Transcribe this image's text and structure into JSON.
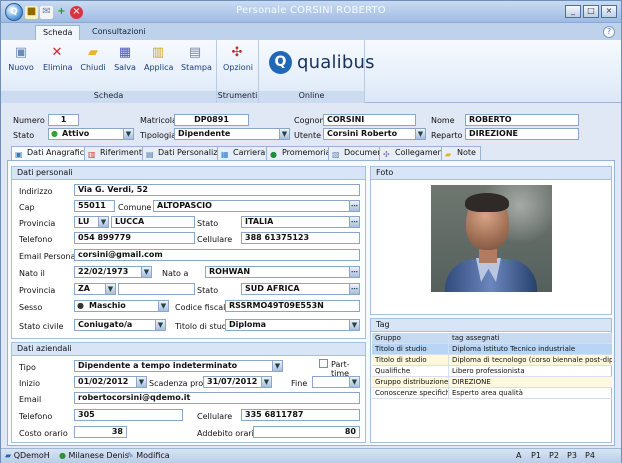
{
  "window": {
    "title": "Personale CORSINI ROBERTO"
  },
  "quick_access": [
    "document-icon",
    "email-icon",
    "add-icon",
    "close-icon"
  ],
  "ribbon_tabs": {
    "active": "Scheda",
    "other": "Consultazioni"
  },
  "ribbon": {
    "scheda": {
      "label": "Scheda",
      "buttons": [
        "Nuovo",
        "Elimina",
        "Chiudi",
        "Salva",
        "Applica",
        "Stampa"
      ]
    },
    "strumenti": {
      "label": "Strumenti",
      "buttons": [
        "Opzioni"
      ]
    },
    "online": {
      "label": "Online",
      "brand": "qualibus"
    }
  },
  "header": {
    "numero_label": "Numero",
    "numero": "1",
    "matricola_label": "Matricola",
    "matricola": "DP0891",
    "cognome_label": "Cognome",
    "cognome": "CORSINI",
    "nome_label": "Nome",
    "nome": "ROBERTO",
    "stato_label": "Stato",
    "stato": "Attivo",
    "tipologia_label": "Tipologia",
    "tipologia": "Dipendente",
    "utente_label": "Utente",
    "utente": "Corsini Roberto",
    "reparto_label": "Reparto",
    "reparto": "DIREZIONE"
  },
  "tabs": [
    "Dati Anagrafici",
    "Riferimenti",
    "Dati Personalizzati",
    "Carriera",
    "Promemoria",
    "Documenti",
    "Collegamenti",
    "Note"
  ],
  "dati_personali": {
    "title": "Dati personali",
    "indirizzo_label": "Indirizzo",
    "indirizzo": "Via G. Verdi, 52",
    "cap_label": "Cap",
    "cap": "55011",
    "comune_label": "Comune",
    "comune": "ALTOPASCIO",
    "provincia_label": "Provincia",
    "provincia_sigla": "LU",
    "provincia": "LUCCA",
    "stato_label": "Stato",
    "stato": "ITALIA",
    "telefono_label": "Telefono",
    "telefono": "054 899779",
    "cellulare_label": "Cellulare",
    "cellulare": "388 61375123",
    "email_label": "Email Personale",
    "email": "corsini@gmail.com",
    "nato_il_label": "Nato il",
    "nato_il": "22/02/1973",
    "nato_a_label": "Nato a",
    "nato_a": "ROHWAN",
    "provincia2_label": "Provincia",
    "provincia2": "ZA",
    "stato2_label": "Stato",
    "stato2": "SUD AFRICA",
    "sesso_label": "Sesso",
    "sesso": "Maschio",
    "codice_fiscale_label": "Codice fiscale",
    "codice_fiscale": "RSSRMO49T09E553N",
    "stato_civile_label": "Stato civile",
    "stato_civile": "Coniugato/a",
    "titolo_studio_label": "Titolo di studio",
    "titolo_studio": "Diploma"
  },
  "dati_aziendali": {
    "title": "Dati aziendali",
    "tipo_label": "Tipo",
    "tipo": "Dipendente a tempo indeterminato",
    "part_time": "Part-time",
    "inizio_label": "Inizio",
    "inizio": "01/02/2012",
    "scadenza_label": "Scadenza prova",
    "scadenza": "31/07/2012",
    "fine_label": "Fine",
    "fine": "",
    "email_label": "Email",
    "email": "robertocorsini@qdemo.it",
    "telefono_label": "Telefono",
    "telefono": "305",
    "cellulare_label": "Cellulare",
    "cellulare": "335 6811787",
    "costo_label": "Costo orario",
    "costo": "38",
    "addebito_label": "Addebito orario",
    "addebito": "80"
  },
  "foto": {
    "title": "Foto"
  },
  "tag": {
    "title": "Tag",
    "headers": [
      "Gruppo",
      "tag assegnati"
    ],
    "rows": [
      [
        "Titolo di studio",
        "Diploma Istituto Tecnico industriale"
      ],
      [
        "Titolo di studio",
        "Diploma di tecnologo (corso biennale post-diploma)"
      ],
      [
        "Qualifiche",
        "Libero professionista"
      ],
      [
        "Gruppo distribuzione",
        "DIREZIONE"
      ],
      [
        "Conoscenze specifiche",
        "Esperto area qualità"
      ]
    ]
  },
  "status": {
    "left": "QDemoH",
    "user": "Milanese Denis",
    "mode": "Modifica",
    "right": [
      "A",
      "P1",
      "P2",
      "P3",
      "P4"
    ]
  }
}
